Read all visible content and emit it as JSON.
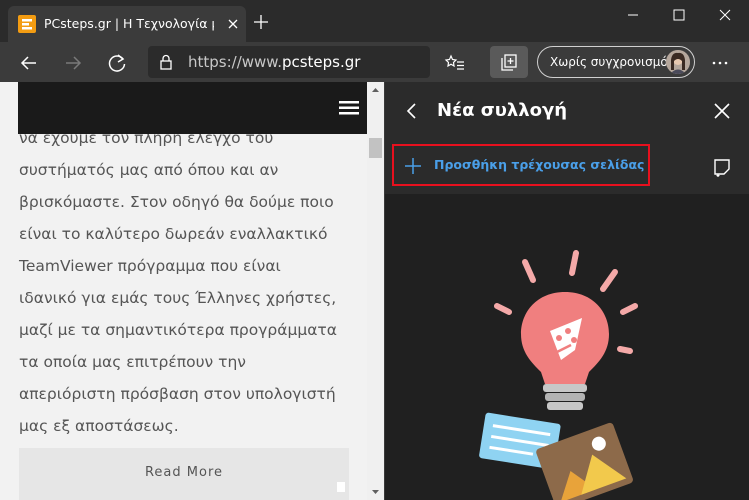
{
  "browser": {
    "tab": {
      "title": "PCsteps.gr | Η Τεχνολογία με Απ"
    },
    "address": {
      "url_host": "https://www.",
      "url_domain": "pcsteps.gr"
    },
    "sync_button": {
      "label": "Χωρίς συγχρονισμό"
    }
  },
  "page": {
    "article_lines": [
      "να έχουμε τον πλήρη έλεγχο του",
      "συστήματός μας από όπου και αν",
      "βρισκόμαστε. Στον οδηγό θα δούμε ποιο",
      "είναι το καλύτερο δωρεάν εναλλακτικό",
      "TeamViewer πρόγραμμα που είναι",
      "ιδανικό για εμάς τους Έλληνες χρήστες,",
      "μαζί με τα σημαντικότερα προγράμματα",
      "τα οποία μας επιτρέπουν την",
      "απεριόριστη πρόσβαση στον υπολογιστή",
      "μας εξ αποστάσεως."
    ],
    "read_more": "Read More"
  },
  "collections": {
    "title": "Νέα συλλογή",
    "add_current_page": "Προσθήκη τρέχουσας σελίδας"
  },
  "colors": {
    "accent_blue": "#4a9fe8",
    "highlight_red": "#e8101e",
    "favicon_orange": "#f39c12"
  },
  "icons": [
    "favicon-icon",
    "tab-close-icon",
    "new-tab-icon",
    "minimize-icon",
    "maximize-icon",
    "window-close-icon",
    "back-arrow-icon",
    "forward-arrow-icon",
    "refresh-icon",
    "lock-icon",
    "favorites-icon",
    "collections-icon",
    "more-icon",
    "hamburger-icon",
    "pane-back-icon",
    "pane-close-icon",
    "plus-icon",
    "add-note-icon",
    "lightbulb-illustration"
  ]
}
